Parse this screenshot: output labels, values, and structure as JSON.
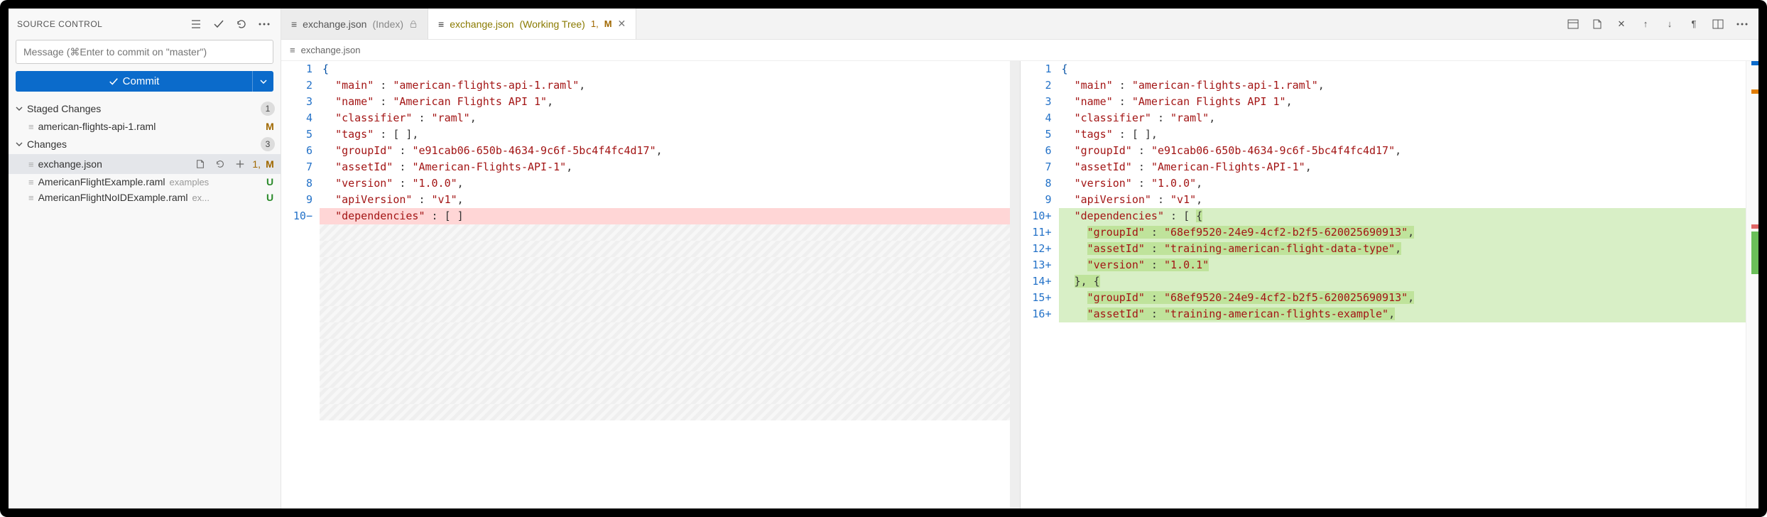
{
  "sidebar": {
    "title": "SOURCE CONTROL",
    "commit_placeholder": "Message (⌘Enter to commit on \"master\")",
    "commit_button": "Commit",
    "sections": [
      {
        "label": "Staged Changes",
        "count": "1"
      },
      {
        "label": "Changes",
        "count": "3"
      }
    ],
    "staged_files": [
      {
        "name": "american-flights-api-1.raml",
        "status": "M"
      }
    ],
    "changed_files": [
      {
        "name": "exchange.json",
        "status": "M",
        "num": "1,"
      },
      {
        "name": "AmericanFlightExample.raml",
        "dir": "examples",
        "status": "U"
      },
      {
        "name": "AmericanFlightNoIDExample.raml",
        "dir": "ex...",
        "status": "U"
      }
    ]
  },
  "tabs": {
    "left": {
      "label": "exchange.json",
      "suffix": "(Index)"
    },
    "right": {
      "label": "exchange.json",
      "suffix": "(Working Tree)",
      "status_num": "1,",
      "status_letter": "M"
    }
  },
  "breadcrumb": {
    "file": "exchange.json"
  },
  "diff": {
    "left_lines": [
      {
        "n": "1",
        "html": "<span class='tok-brace'>{</span>"
      },
      {
        "n": "2",
        "html": "  <span class='tok-key'>\"main\"</span> : <span class='tok-str'>\"american-flights-api-1.raml\"</span>,"
      },
      {
        "n": "3",
        "html": "  <span class='tok-key'>\"name\"</span> : <span class='tok-str'>\"American Flights API 1\"</span>,"
      },
      {
        "n": "4",
        "html": "  <span class='tok-key'>\"classifier\"</span> : <span class='tok-str'>\"raml\"</span>,"
      },
      {
        "n": "5",
        "html": "  <span class='tok-key'>\"tags\"</span> : [ ],"
      },
      {
        "n": "6",
        "html": "  <span class='tok-key'>\"groupId\"</span> : <span class='tok-str'>\"e91cab06-650b-4634-9c6f-5bc4f4fc4d17\"</span>,"
      },
      {
        "n": "7",
        "html": "  <span class='tok-key'>\"assetId\"</span> : <span class='tok-str'>\"American-Flights-API-1\"</span>,"
      },
      {
        "n": "8",
        "html": "  <span class='tok-key'>\"version\"</span> : <span class='tok-str'>\"1.0.0\"</span>,"
      },
      {
        "n": "9",
        "html": "  <span class='tok-key'>\"apiVersion\"</span> : <span class='tok-str'>\"v1\"</span>,"
      },
      {
        "n": "10",
        "sign": "−",
        "cls": "diff-removed",
        "html": "  <span class='tok-key'>\"dependencies\"</span> : [ ]"
      }
    ],
    "right_lines": [
      {
        "n": "1",
        "html": "<span class='tok-brace'>{</span>"
      },
      {
        "n": "2",
        "html": "  <span class='tok-key'>\"main\"</span> : <span class='tok-str'>\"american-flights-api-1.raml\"</span>,"
      },
      {
        "n": "3",
        "html": "  <span class='tok-key'>\"name\"</span> : <span class='tok-str'>\"American Flights API 1\"</span>,"
      },
      {
        "n": "4",
        "html": "  <span class='tok-key'>\"classifier\"</span> : <span class='tok-str'>\"raml\"</span>,"
      },
      {
        "n": "5",
        "html": "  <span class='tok-key'>\"tags\"</span> : [ ],"
      },
      {
        "n": "6",
        "html": "  <span class='tok-key'>\"groupId\"</span> : <span class='tok-str'>\"e91cab06-650b-4634-9c6f-5bc4f4fc4d17\"</span>,"
      },
      {
        "n": "7",
        "html": "  <span class='tok-key'>\"assetId\"</span> : <span class='tok-str'>\"American-Flights-API-1\"</span>,"
      },
      {
        "n": "8",
        "html": "  <span class='tok-key'>\"version\"</span> : <span class='tok-str'>\"1.0.0\"</span>,"
      },
      {
        "n": "9",
        "html": "  <span class='tok-key'>\"apiVersion\"</span> : <span class='tok-str'>\"v1\"</span>,"
      },
      {
        "n": "10",
        "sign": "+",
        "cls": "diff-added",
        "html": "  <span class='tok-key'>\"dependencies\"</span> : [ <span class='diff-added-strong'>{</span>"
      },
      {
        "n": "11",
        "sign": "+",
        "cls": "diff-added",
        "html": "    <span class='diff-added-strong'><span class='tok-key'>\"groupId\"</span> : <span class='tok-str'>\"68ef9520-24e9-4cf2-b2f5-620025690913\"</span>,</span>"
      },
      {
        "n": "12",
        "sign": "+",
        "cls": "diff-added",
        "html": "    <span class='diff-added-strong'><span class='tok-key'>\"assetId\"</span> : <span class='tok-str'>\"training-american-flight-data-type\"</span>,</span>"
      },
      {
        "n": "13",
        "sign": "+",
        "cls": "diff-added",
        "html": "    <span class='diff-added-strong'><span class='tok-key'>\"version\"</span> : <span class='tok-str'>\"1.0.1\"</span></span>"
      },
      {
        "n": "14",
        "sign": "+",
        "cls": "diff-added",
        "html": "  <span class='diff-added-strong'>}, {</span>"
      },
      {
        "n": "15",
        "sign": "+",
        "cls": "diff-added",
        "html": "    <span class='diff-added-strong'><span class='tok-key'>\"groupId\"</span> : <span class='tok-str'>\"68ef9520-24e9-4cf2-b2f5-620025690913\"</span>,</span>"
      },
      {
        "n": "16",
        "sign": "+",
        "cls": "diff-added",
        "html": "    <span class='diff-added-strong'><span class='tok-key'>\"assetId\"</span> : <span class='tok-str'>\"training-american-flights-example\"</span>,</span>"
      }
    ]
  }
}
